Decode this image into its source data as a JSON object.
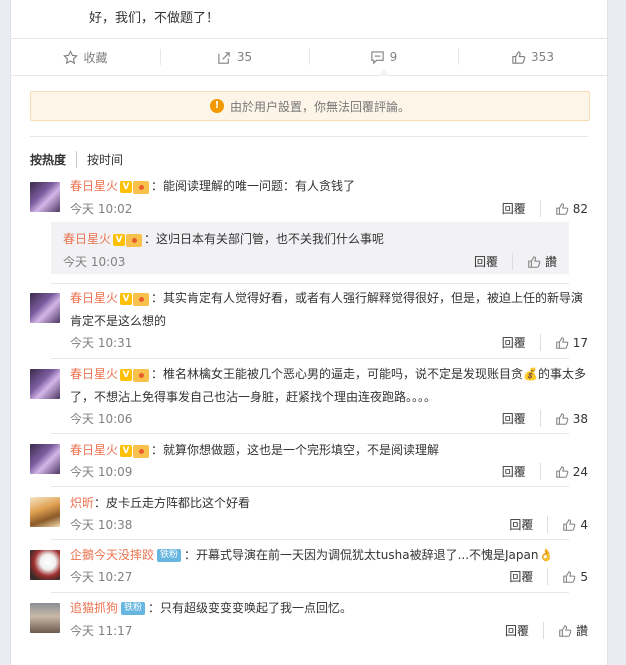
{
  "post": {
    "text_line1": "",
    "text_line2": "好，我们，不做题了！"
  },
  "actions": [
    {
      "label": "收藏",
      "icon": "star-icon"
    },
    {
      "label": "35",
      "icon": "share-icon"
    },
    {
      "label": "9",
      "icon": "comment-icon"
    },
    {
      "label": "353",
      "icon": "like-icon"
    }
  ],
  "notice": {
    "text": "由於用户設置，你無法回覆評論。"
  },
  "sort": {
    "hot": "按热度",
    "time": "按时间"
  },
  "reply_label": "回覆",
  "comments": [
    {
      "user": "春日星火",
      "text": "能阅读理解的唯一问题：有人贪钱了",
      "time": "今天 10:02",
      "likes": "82",
      "avatar": "purple",
      "v": true,
      "fan": true
    },
    {
      "user": "春日星火",
      "text": "这归日本有关部门管，也不关我们什么事呢",
      "time": "今天 10:03",
      "likes": "讚",
      "reply": true,
      "v": true,
      "fan": true
    },
    {
      "user": "春日星火",
      "text": "其实肯定有人觉得好看，或者有人强行解释觉得很好，但是，被迫上任的新导演肯定不是这么想的",
      "time": "今天 10:31",
      "likes": "17",
      "avatar": "purple",
      "v": true,
      "fan": true
    },
    {
      "user": "春日星火",
      "text": "椎名林檎女王能被几个恶心男的逼走，可能吗，说不定是发现账目贪💰的事太多了，不想沾上免得事发自己也沾一身脏，赶紧找个理由连夜跑路。。。。",
      "time": "今天 10:06",
      "likes": "38",
      "avatar": "purple",
      "v": true,
      "fan": true
    },
    {
      "user": "春日星火",
      "text": "就算你想做题，这也是一个完形填空，不是阅读理解",
      "time": "今天 10:09",
      "likes": "24",
      "avatar": "purple",
      "v": true,
      "fan": true
    },
    {
      "user": "炽昕",
      "text": "皮卡丘走方阵都比这个好看",
      "time": "今天 10:38",
      "likes": "4",
      "avatar": "food"
    },
    {
      "user": "企鵝今天没摔跤",
      "text": "开幕式导演在前一天因为调侃犹太tusha被辞退了...不愧是Japan👌",
      "time": "今天 10:27",
      "likes": "5",
      "avatar": "dog",
      "tiefen": "铁粉"
    },
    {
      "user": "追猫抓狗",
      "text": "只有超级变变变唤起了我一点回忆。",
      "time": "今天 11:17",
      "likes": "讚",
      "avatar": "cat",
      "tiefen": "铁粉"
    }
  ]
}
